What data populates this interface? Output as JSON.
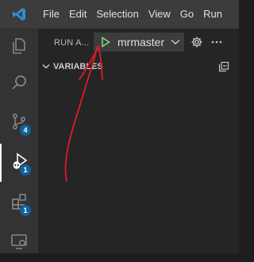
{
  "menubar": {
    "items": [
      "File",
      "Edit",
      "Selection",
      "View",
      "Go",
      "Run"
    ]
  },
  "activity_bar": {
    "items": [
      {
        "name": "explorer",
        "badge": ""
      },
      {
        "name": "search",
        "badge": ""
      },
      {
        "name": "source-control",
        "badge": "4"
      },
      {
        "name": "run-and-debug",
        "badge": "1"
      },
      {
        "name": "extensions",
        "badge": "1"
      },
      {
        "name": "remote-explorer",
        "badge": ""
      }
    ]
  },
  "run_panel": {
    "title": "RUN A...",
    "configuration": "mrmaster",
    "sections": [
      {
        "title": "VARIABLES"
      }
    ]
  },
  "colors": {
    "accent": "#0e639c",
    "play": "#89d185",
    "annotation": "#e01b24"
  }
}
